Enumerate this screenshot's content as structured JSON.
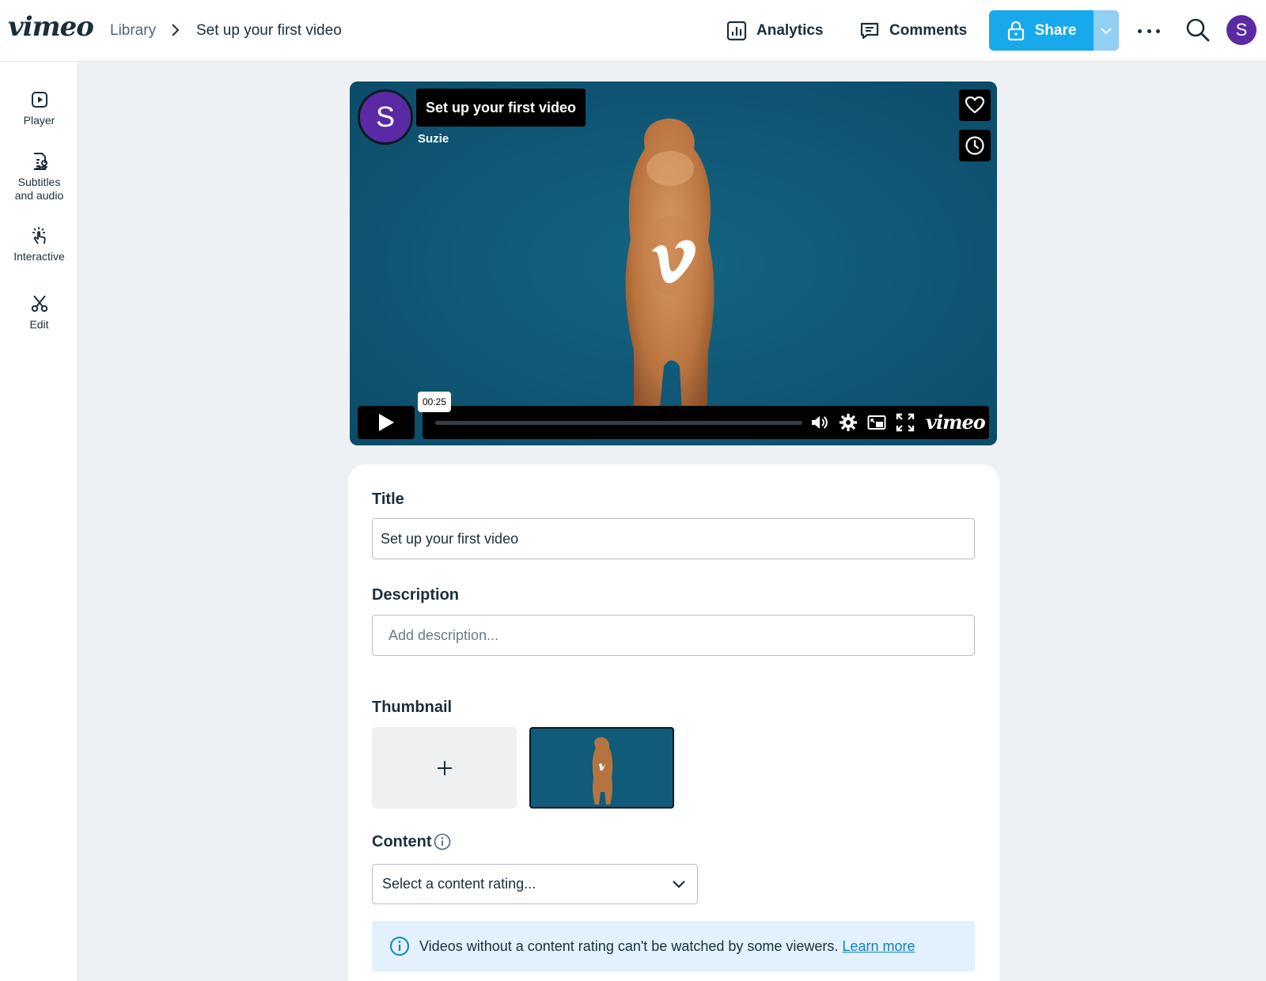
{
  "header": {
    "logo": "vimeo",
    "breadcrumb": {
      "root": "Library",
      "current": "Set up your first video"
    },
    "analytics_label": "Analytics",
    "comments_label": "Comments",
    "share_label": "Share",
    "avatar_initial": "S",
    "accent": "#17a9ec"
  },
  "sidebar": {
    "items": [
      {
        "label": "Player",
        "icon": "play-square-icon"
      },
      {
        "label": "Subtitles and audio",
        "icon": "subtitles-icon"
      },
      {
        "label": "Interactive",
        "icon": "tap-icon"
      },
      {
        "label": "Edit",
        "icon": "scissors-icon"
      }
    ]
  },
  "player": {
    "title": "Set up your first video",
    "owner": "Suzie",
    "owner_initial": "S",
    "time_tooltip": "00:25",
    "progress": 0,
    "logo": "vimeo"
  },
  "form": {
    "title_label": "Title",
    "title_value": "Set up your first video",
    "description_label": "Description",
    "description_placeholder": "Add description...",
    "thumbnail_label": "Thumbnail",
    "content_label": "Content",
    "content_select": "Select a content rating...",
    "notice_text": "Videos without a content rating can't be watched by some viewers.",
    "notice_link": "Learn more"
  }
}
